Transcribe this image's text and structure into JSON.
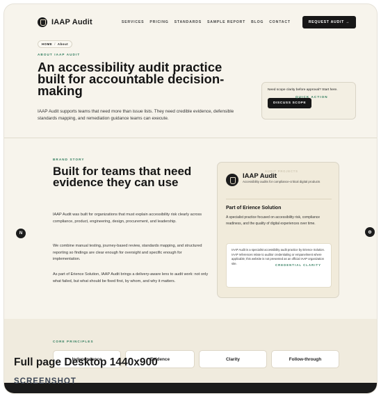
{
  "nav": {
    "brand": "IAAP Audit",
    "links": [
      "SERVICES",
      "PRICING",
      "STANDARDS",
      "SAMPLE REPORT",
      "BLOG",
      "CONTACT"
    ],
    "cta": "REQUEST AUDIT →"
  },
  "hero": {
    "breadcrumb": [
      "HOME",
      "/",
      "About"
    ],
    "eyebrow": "ABOUT IAAP AUDIT",
    "title": "An accessibility audit practice built for accountable decision-making",
    "body": "IAAP Audit supports teams that need more than issue lists. They need credible evidence, defensible standards mapping, and remediation guidance teams can execute."
  },
  "quick_action": {
    "eyebrow": "QUICK ACTION",
    "text": "Need scope clarity before approval? Start here.",
    "button": "DISCUSS SCOPE"
  },
  "story": {
    "eyebrow": "BRAND STORY",
    "title": "Built for teams that need evidence they can use",
    "paragraphs": [
      "IAAP Audit was built for organizations that must explain accessibility risk clearly across compliance, product, engineering, design, procurement, and leadership.",
      "We combine manual testing, journey-based review, standards mapping, and structured reporting so findings are clear enough for oversight and specific enough for implementation.",
      "As part of Erience Solution, IAAP Audit brings a delivery-aware lens to audit work: not only what failed, but what should be fixed first, by whom, and why it matters."
    ]
  },
  "brand_card": {
    "ghost": "AUDIT PROJECTS",
    "title": "IAAP Audit",
    "subtitle": "Accessibility audits for compliance-critical digital products",
    "heading": "Part of Erience Solution",
    "text": "A specialist practice focused on accessibility risk, compliance readiness, and the quality of digital experiences over time.",
    "credential_eyebrow": "CREDENTIAL CLARITY",
    "credential_text": "IAAP Audit is a specialist accessibility audit practice by Erience Solution. IAAP references relate to auditor credentialing or empanelment where applicable; this website is not presented as an official IAAP organization site."
  },
  "side_buttons": {
    "left": "N",
    "right": "⚙"
  },
  "principles": {
    "eyebrow": "CORE PRINCIPLES",
    "items": [
      "Independence",
      "Evidence",
      "Clarity",
      "Follow-through"
    ]
  },
  "watermark": {
    "title": "Full page Desktop 1440x900",
    "subtitle": "SCREENSHOT"
  }
}
